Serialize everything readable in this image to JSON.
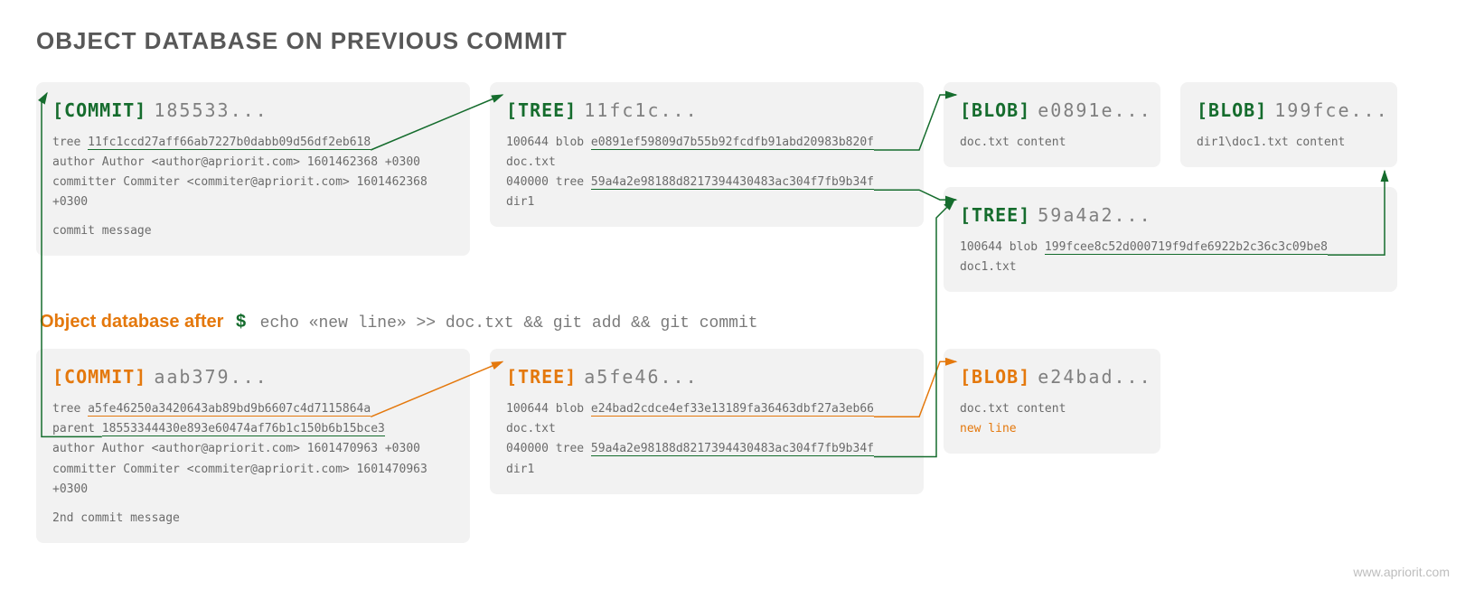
{
  "title": "OBJECT DATABASE ON PREVIOUS COMMIT",
  "watermark": "www.apriorit.com",
  "interline": {
    "label": "Object database after",
    "dollar": "$",
    "cmd": "echo «new line» >> doc.txt && git add && git commit"
  },
  "commit1": {
    "type": "[COMMIT]",
    "hash": "185533...",
    "tree_prefix": "tree ",
    "tree_hash": "11fc1ccd27aff66ab7227b0dabb09d56df2eb618",
    "author": "author Author <author@apriorit.com> 1601462368 +0300",
    "committer": "committer Commiter <commiter@apriorit.com> 1601462368 +0300",
    "msg": "commit message"
  },
  "tree1": {
    "type": "[TREE]",
    "hash": "11fc1c...",
    "l1_prefix": "100644 blob ",
    "l1_hash": "e0891ef59809d7b55b92fcdfb91abd20983b820f",
    "l1_suffix": "  doc.txt",
    "l2_prefix": "040000 tree ",
    "l2_hash": "59a4a2e98188d8217394430483ac304f7fb9b34f",
    "l2_suffix": "  dir1"
  },
  "blob1": {
    "type": "[BLOB]",
    "hash": "e0891e...",
    "content": "doc.txt content"
  },
  "blob2": {
    "type": "[BLOB]",
    "hash": "199fce...",
    "content": "dir1\\doc1.txt content"
  },
  "tree2": {
    "type": "[TREE]",
    "hash": "59a4a2...",
    "l1_prefix": "100644 blob ",
    "l1_hash": "199fcee8c52d000719f9dfe6922b2c36c3c09be8",
    "l1_suffix": "   doc1.txt"
  },
  "commit2": {
    "type": "[COMMIT]",
    "hash": "aab379...",
    "tree_prefix": "tree ",
    "tree_hash": "a5fe46250a3420643ab89bd9b6607c4d7115864a",
    "parent_prefix": "parent ",
    "parent_hash": "18553344430e893e60474af76b1c150b6b15bce3",
    "author": "author Author <author@apriorit.com> 1601470963 +0300",
    "committer": "committer Commiter <commiter@apriorit.com> 1601470963 +0300",
    "msg": "2nd commit message"
  },
  "tree3": {
    "type": "[TREE]",
    "hash": "a5fe46...",
    "l1_prefix": "100644 blob ",
    "l1_hash": "e24bad2cdce4ef33e13189fa36463dbf27a3eb66",
    "l1_suffix": "  doc.txt",
    "l2_prefix": "040000 tree ",
    "l2_hash": "59a4a2e98188d8217394430483ac304f7fb9b34f",
    "l2_suffix": "  dir1"
  },
  "blob3": {
    "type": "[BLOB]",
    "hash": "e24bad...",
    "content": "doc.txt content",
    "newline": "new line"
  }
}
